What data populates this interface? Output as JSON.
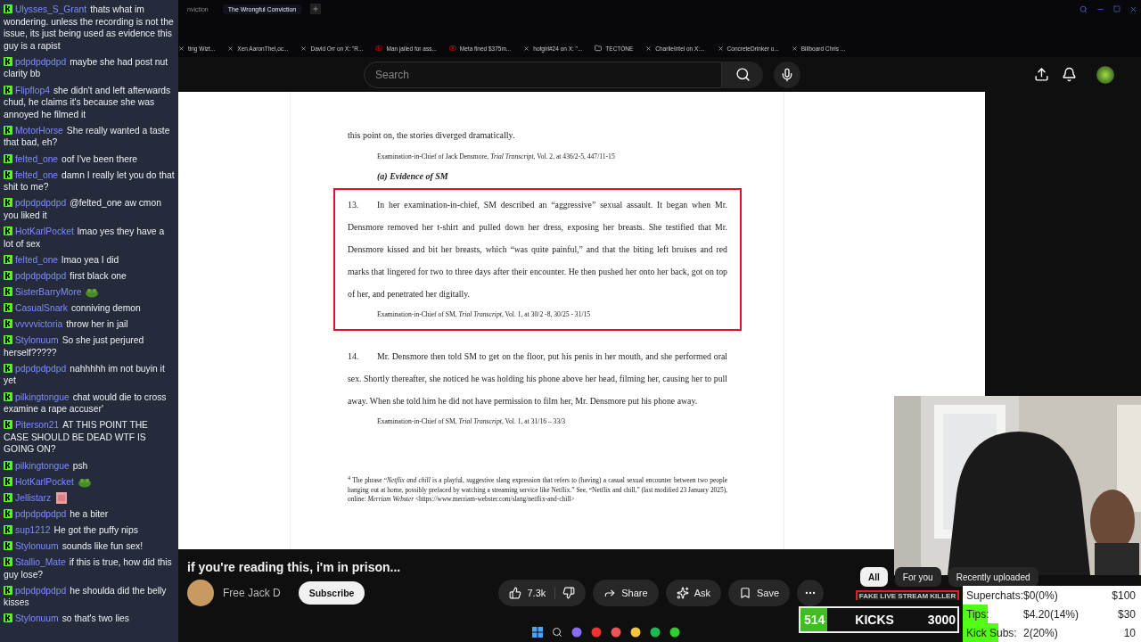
{
  "browser": {
    "tabs": [
      {
        "title": "nviction",
        "selected": false
      },
      {
        "title": "The Wrongful Conviction",
        "selected": true
      }
    ],
    "bookmarks": [
      {
        "kind": "x",
        "title": "ting Wizt..."
      },
      {
        "kind": "x",
        "title": "Xen AaronThel,oc..."
      },
      {
        "kind": "x",
        "title": "David Orr on X: \"R..."
      },
      {
        "kind": "youtube",
        "title": "Man jailed for ass..."
      },
      {
        "kind": "youtube",
        "title": "Meta fined $375m..."
      },
      {
        "kind": "x",
        "title": "hotgirl#24 on X: \"..."
      },
      {
        "kind": "folder",
        "title": "TECTONE"
      },
      {
        "kind": "x",
        "title": "CharlieIntel on X:..."
      },
      {
        "kind": "x",
        "title": "ConcreteDrinker o..."
      },
      {
        "kind": "x",
        "title": "Billboard Chris ..."
      }
    ]
  },
  "youtube": {
    "search": {
      "placeholder": "Search"
    }
  },
  "document": {
    "blocks": [
      {
        "kind": "text",
        "text": "this point on, the stories diverged dramatically."
      },
      {
        "kind": "cite",
        "text": "Examination-in-Chief of Jack Densmore, *Trial Transcript*, Vol. 2, at 436/2-5, 447/11-15"
      },
      {
        "kind": "heading",
        "text": "(a) Evidence of SM"
      },
      {
        "kind": "para",
        "number": "13.",
        "highlighted": true,
        "text": "In her examination-in-chief, SM described an “aggressive” sexual assault. It began when Mr. Densmore removed her t-shirt and pulled down her dress, exposing her breasts. She testified that Mr. Densmore kissed and bit her breasts, which “was quite painful,” and that the biting left bruises and red marks that lingered for two to three days after their encounter. He then pushed her onto her back, got on top of her, and penetrated her digitally.",
        "cite": "Examination-in-Chief of SM, *Trial Transcript*, Vol. 1, at 30/2 -8, 30/25 - 31/15"
      },
      {
        "kind": "para",
        "number": "14.",
        "highlighted": false,
        "text": "Mr. Densmore then told SM to get on the floor, put his penis in her mouth, and she performed oral sex. Shortly thereafter, she noticed he was holding his phone above her head, filming her, causing her to pull away. When she told him he did not have permission to film her, Mr. Densmore put his phone away.",
        "cite": "Examination-in-Chief of SM, *Trial Transcript*, Vol. 1, at 31/16 – 33/3"
      },
      {
        "kind": "footnote",
        "text": "$^{4}$ The phrase “*Netflix and chill* is a playful, suggestive slang expression that refers to (having) a casual sexual encounter between two people hanging out at home, possibly prefaced by watching a streaming service like Netflix.” See, “Netflix and chill,” (last modified 23 January 2025), online: *Merriam Webster* <https://www.merriam-webster.com/slang/netflix-and-chill>"
      }
    ]
  },
  "video": {
    "title": "if you're reading this, i'm in prison...",
    "channel": "Free Jack D",
    "subscribe": "Subscribe",
    "likes": "7.3k",
    "actions": [
      {
        "kind": "share",
        "label": "Share"
      },
      {
        "kind": "ask",
        "label": "Ask"
      },
      {
        "kind": "save",
        "label": "Save"
      }
    ]
  },
  "chips": [
    {
      "label": "All",
      "selected": true
    },
    {
      "label": "For you",
      "selected": false
    },
    {
      "label": "Recently uploaded",
      "selected": false
    }
  ],
  "chat": [
    {
      "user": "Ulysses_S_Grant",
      "kind": "text",
      "text": "thats what im wondering. unless the recording is not the issue, its just being used as evidence this guy is a rapist"
    },
    {
      "user": "pdpdpdpdpd",
      "kind": "text",
      "text": "maybe she had post nut clarity bb"
    },
    {
      "user": "Flipflop4",
      "kind": "text",
      "text": "she didn't and left afterwards chud, he claims it's because she was annoyed he filmed it"
    },
    {
      "user": "MotorHorse",
      "kind": "text",
      "text": "She really wanted a taste that bad, eh?"
    },
    {
      "user": "felted_one",
      "kind": "text",
      "text": "oof I've been there"
    },
    {
      "user": "felted_one",
      "kind": "text",
      "text": "damn I really let you do that shit to me?"
    },
    {
      "user": "pdpdpdpdpd",
      "kind": "text",
      "text": "@felted_one aw cmon you liked it"
    },
    {
      "user": "HotKarlPocket",
      "kind": "text",
      "text": "lmao yes they have a lot of sex"
    },
    {
      "user": "felted_one",
      "kind": "text",
      "text": "lmao yea I did"
    },
    {
      "user": "pdpdpdpdpd",
      "kind": "text",
      "text": "first black one"
    },
    {
      "user": "SisterBarryMore",
      "kind": "frog"
    },
    {
      "user": "CasualSnark",
      "kind": "text",
      "text": "conniving demon"
    },
    {
      "user": "vvvvvictoria",
      "kind": "text",
      "text": "throw her in jail"
    },
    {
      "user": "Stylonuum",
      "kind": "text",
      "text": "So she just perjured herself?????"
    },
    {
      "user": "pdpdpdpdpd",
      "kind": "text",
      "text": "nahhhhh im not buyin it yet"
    },
    {
      "user": "pilkingtongue",
      "kind": "text",
      "text": "chat would die to cross examine a rape accuser'"
    },
    {
      "user": "Piterson21",
      "kind": "text",
      "text": "AT THIS POINT THE CASE SHOULD BE DEAD WTF IS GOING ON?"
    },
    {
      "user": "pilkingtongue",
      "kind": "text",
      "text": "psh"
    },
    {
      "user": "HotKarlPocket",
      "kind": "frog"
    },
    {
      "user": "Jellistarz",
      "kind": "face"
    },
    {
      "user": "pdpdpdpdpd",
      "kind": "text",
      "text": "he a biter"
    },
    {
      "user": "sup1212",
      "kind": "text",
      "text": "He got the puffy nips"
    },
    {
      "user": "Stylonuum",
      "kind": "text",
      "text": "sounds like fun sex!"
    },
    {
      "user": "Stallio_Mate",
      "kind": "text",
      "text": "if this is true, how did this guy lose?"
    },
    {
      "user": "pdpdpdpdpd",
      "kind": "text",
      "text": "he shoulda did the belly kisses"
    },
    {
      "user": "Stylonuum",
      "kind": "text",
      "text": "so that's two lies"
    }
  ],
  "kicks": {
    "count": "514",
    "label": "KICKS",
    "goal": "3000",
    "level": 0.17,
    "banner": "FAKE LIVE STREAM KILLER"
  },
  "stats": [
    {
      "label": "Superchats:",
      "value": "$0(0%)",
      "goal": "$100"
    },
    {
      "label": "Tips:",
      "value": "$4.20(14%)",
      "goal": "$30",
      "level": 0.14
    },
    {
      "label": "Kick Subs:",
      "value": "2(20%)",
      "goal": "10",
      "level": 0.2
    }
  ]
}
